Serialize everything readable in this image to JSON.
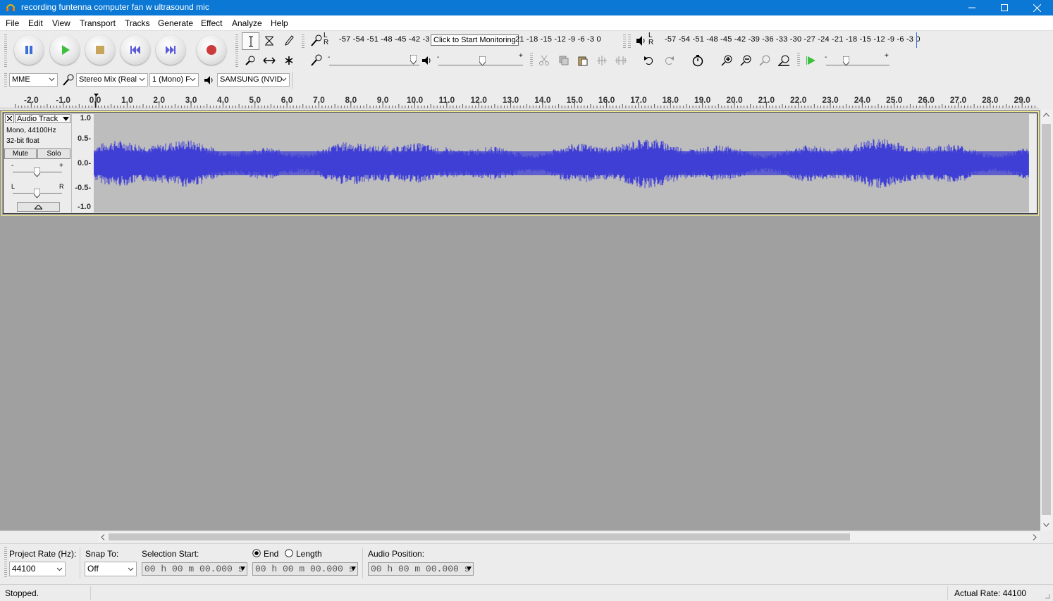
{
  "window": {
    "title": "recording funtenna computer fan w ultrasound mic"
  },
  "menu": [
    "File",
    "Edit",
    "View",
    "Transport",
    "Tracks",
    "Generate",
    "Effect",
    "Analyze",
    "Help"
  ],
  "meters": {
    "record_scale": "-57 -54 -51 -48 -45 -42 -3",
    "record_scale_tail": "21 -18 -15 -12  -9  -6  -3  0",
    "monitor_tooltip": "Click to Start Monitoring",
    "playback_scale": "-57 -54 -51 -48 -45 -42 -39 -36 -33 -30 -27 -24 -21 -18 -15 -12  -9  -6  -3  0"
  },
  "device": {
    "host": "MME",
    "recording_device": "Stereo Mix (Real",
    "channels": "1 (Mono) F",
    "playback_device": "SAMSUNG (NVID"
  },
  "timeline": {
    "labels": [
      "-2.0",
      "-1.0",
      "0.0",
      "1.0",
      "2.0",
      "3.0",
      "4.0",
      "5.0",
      "6.0",
      "7.0",
      "8.0",
      "9.0",
      "10.0",
      "11.0",
      "12.0",
      "13.0",
      "14.0",
      "15.0",
      "16.0",
      "17.0",
      "18.0",
      "19.0",
      "20.0",
      "21.0",
      "22.0",
      "23.0",
      "24.0",
      "25.0",
      "26.0",
      "27.0",
      "28.0",
      "29.0"
    ]
  },
  "track": {
    "name": "Audio Track",
    "info1": "Mono, 44100Hz",
    "info2": "32-bit float",
    "mute": "Mute",
    "solo": "Solo",
    "gain_minus": "-",
    "gain_plus": "+",
    "pan_left": "L",
    "pan_right": "R",
    "vruler": [
      "1.0",
      "0.5-",
      "0.0-",
      "-0.5-",
      "-1.0"
    ],
    "color": "#3f3fd6"
  },
  "selection_toolbar": {
    "project_rate_label": "Project Rate (Hz):",
    "project_rate": "44100",
    "snap_label": "Snap To:",
    "snap_value": "Off",
    "selection_start_label": "Selection Start:",
    "selection_start": "00 h 00 m 00.000 s",
    "end_label": "End",
    "length_label": "Length",
    "selection_end": "00 h 00 m 00.000 s",
    "audio_position_label": "Audio Position:",
    "audio_position": "00 h 00 m 00.000 s"
  },
  "status": {
    "state": "Stopped.",
    "actual_rate": "Actual Rate: 44100"
  }
}
